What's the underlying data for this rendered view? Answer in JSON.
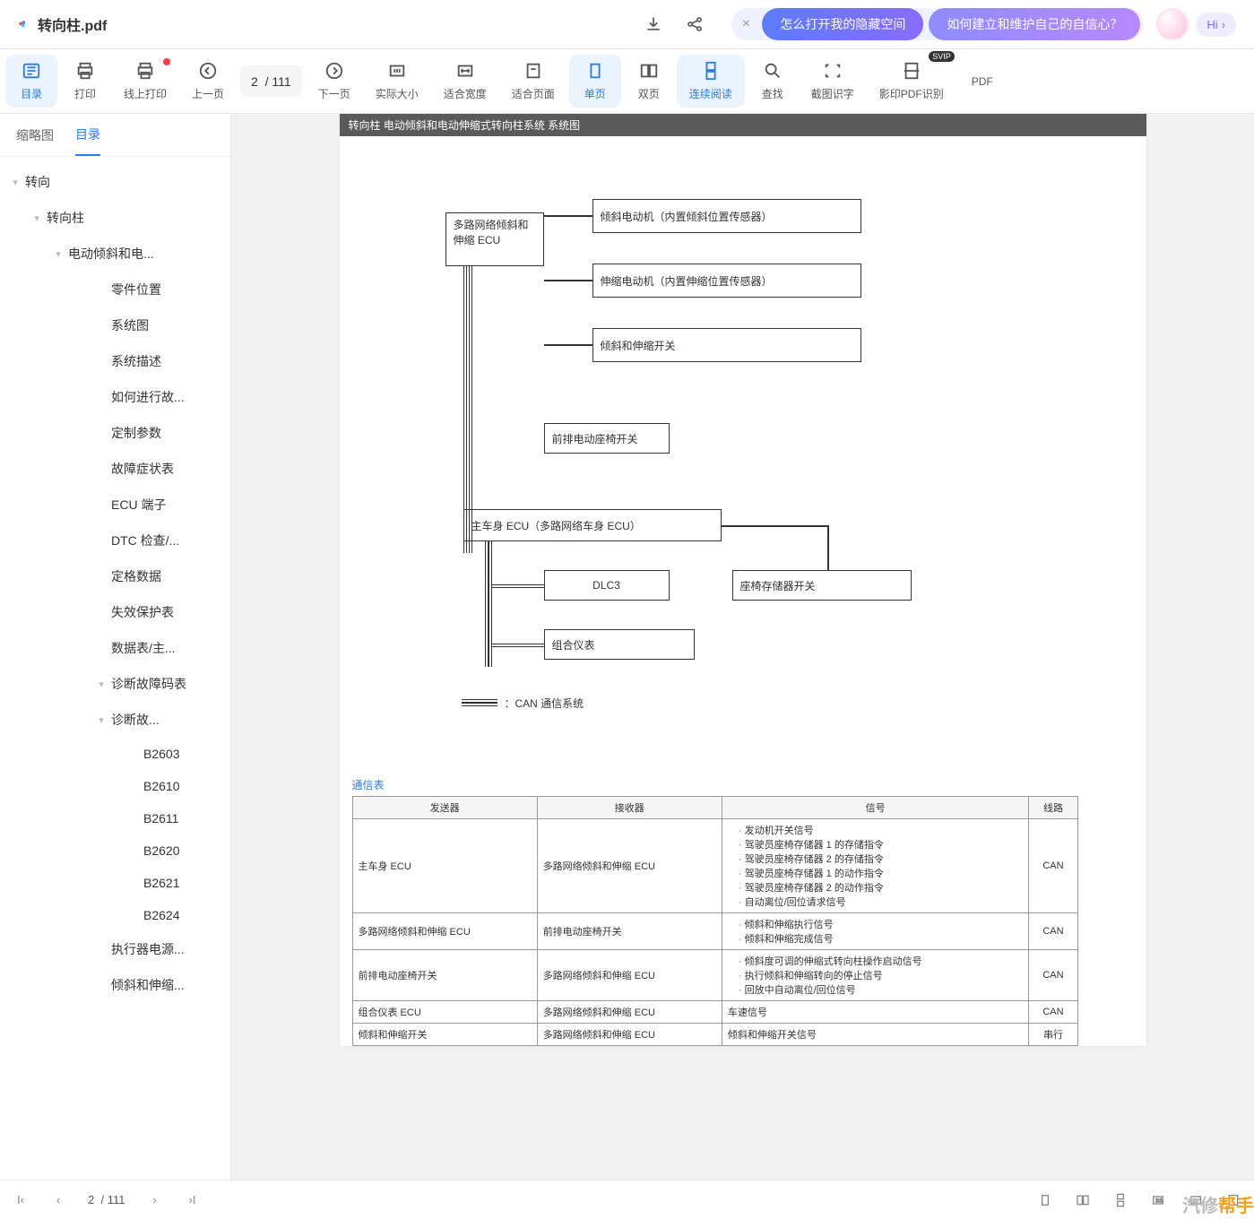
{
  "header": {
    "doc_title": "转向柱.pdf",
    "pills": [
      "怎么打开我的隐藏空间",
      "如何建立和维护自己的自信心？"
    ],
    "hi_label": "Hi"
  },
  "toolbar": {
    "items": [
      {
        "label": "目录"
      },
      {
        "label": "打印"
      },
      {
        "label": "线上打印"
      },
      {
        "label": "上一页"
      },
      {
        "label": "下一页"
      },
      {
        "label": "实际大小"
      },
      {
        "label": "适合宽度"
      },
      {
        "label": "适合页面"
      },
      {
        "label": "单页"
      },
      {
        "label": "双页"
      },
      {
        "label": "连续阅读"
      },
      {
        "label": "查找"
      },
      {
        "label": "截图识字"
      },
      {
        "label": "影印PDF识别"
      },
      {
        "label": "PDF"
      }
    ],
    "page_current": "2",
    "page_total": "/ 111"
  },
  "tabs": [
    "缩略图",
    "目录"
  ],
  "outline": [
    {
      "level": 0,
      "caret": true,
      "label": "转向"
    },
    {
      "level": 1,
      "caret": true,
      "label": "转向柱"
    },
    {
      "level": 2,
      "caret": true,
      "label": "电动倾斜和电..."
    },
    {
      "level": 3,
      "caret": false,
      "label": "零件位置"
    },
    {
      "level": 3,
      "caret": false,
      "label": "系统图"
    },
    {
      "level": 3,
      "caret": false,
      "label": "系统描述"
    },
    {
      "level": 3,
      "caret": false,
      "label": "如何进行故..."
    },
    {
      "level": 3,
      "caret": false,
      "label": "定制参数"
    },
    {
      "level": 3,
      "caret": false,
      "label": "故障症状表"
    },
    {
      "level": 3,
      "caret": false,
      "label": "ECU 端子"
    },
    {
      "level": 3,
      "caret": false,
      "label": "DTC 检查/..."
    },
    {
      "level": 3,
      "caret": false,
      "label": "定格数据"
    },
    {
      "level": 3,
      "caret": false,
      "label": "失效保护表"
    },
    {
      "level": 3,
      "caret": false,
      "label": "数据表/主..."
    },
    {
      "level": 3,
      "caret": true,
      "label": "诊断故障码表"
    },
    {
      "level": 3,
      "caret": true,
      "label": "诊断故..."
    },
    {
      "level": 4,
      "caret": false,
      "label": "B2603"
    },
    {
      "level": 4,
      "caret": false,
      "label": "B2610"
    },
    {
      "level": 4,
      "caret": false,
      "label": "B2611"
    },
    {
      "level": 4,
      "caret": false,
      "label": "B2620"
    },
    {
      "level": 4,
      "caret": false,
      "label": "B2621"
    },
    {
      "level": 4,
      "caret": false,
      "label": "B2624"
    },
    {
      "level": 3,
      "caret": false,
      "label": "执行器电源..."
    },
    {
      "level": 3,
      "caret": false,
      "label": "倾斜和伸缩..."
    }
  ],
  "page_content": {
    "header": "转向柱  电动倾斜和电动伸缩式转向柱系统  系统图",
    "boxes": {
      "ecu": "多路网络倾斜和伸缩 ECU",
      "motor1": "倾斜电动机（内置倾斜位置传感器）",
      "motor2": "伸缩电动机（内置伸缩位置传感器）",
      "switch1": "倾斜和伸缩开关",
      "seat_switch": "前排电动座椅开关",
      "main_ecu": "主车身 ECU（多路网络车身 ECU）",
      "dlc3": "DLC3",
      "mem_switch": "座椅存储器开关",
      "meter": "组合仪表"
    },
    "can_label": "：CAN 通信系统",
    "table_title": "通信表",
    "table_headers": [
      "发送器",
      "接收器",
      "信号",
      "线路"
    ],
    "table_rows": [
      {
        "tx": "主车身 ECU",
        "rx": "多路网络倾斜和伸缩 ECU",
        "signals": [
          "发动机开关信号",
          "驾驶员座椅存储器 1 的存储指令",
          "驾驶员座椅存储器 2 的存储指令",
          "驾驶员座椅存储器 1 的动作指令",
          "驾驶员座椅存储器 2 的动作指令",
          "自动离位/回位请求信号"
        ],
        "line": "CAN"
      },
      {
        "tx": "多路网络倾斜和伸缩 ECU",
        "rx": "前排电动座椅开关",
        "signals": [
          "倾斜和伸缩执行信号",
          "倾斜和伸缩完成信号"
        ],
        "line": "CAN"
      },
      {
        "tx": "前排电动座椅开关",
        "rx": "多路网络倾斜和伸缩 ECU",
        "signals": [
          "倾斜度可调的伸缩式转向柱操作启动信号",
          "执行倾斜和伸缩转向的停止信号",
          "回放中自动离位/回位信号"
        ],
        "line": "CAN"
      },
      {
        "tx": "组合仪表 ECU",
        "rx": "多路网络倾斜和伸缩 ECU",
        "signals": [
          "车速信号"
        ],
        "line": "CAN"
      },
      {
        "tx": "倾斜和伸缩开关",
        "rx": "多路网络倾斜和伸缩 ECU",
        "signals": [
          "倾斜和伸缩开关信号"
        ],
        "line": "串行"
      }
    ]
  },
  "bottom": {
    "page_current": "2",
    "page_total": "/ 111",
    "watermark_a": "汽修",
    "watermark_b": "帮手"
  }
}
